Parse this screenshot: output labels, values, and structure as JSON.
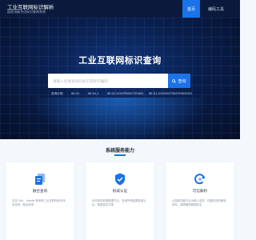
{
  "header": {
    "brand_title": "工业互联网标识解析",
    "brand_subtitle": "国家顶级节点标识查询系统",
    "nav": [
      {
        "label": "首页",
        "active": true
      },
      {
        "label": "编码工具",
        "active": false
      }
    ]
  },
  "hero": {
    "title": "工业互联网标识查询",
    "search": {
      "placeholder": "请输入您要查询的标识或标识编码",
      "value": "",
      "button_label": "查询"
    },
    "examples_label": "查询示例:",
    "examples": [
      "88.111",
      "88.111.1",
      "88.111.1010/PK00217R4811",
      "88.111.1010/0X2T0A22S0N12301"
    ]
  },
  "services": {
    "title": "系统服务能力",
    "cards": [
      {
        "icon": "document-stack-icon",
        "title": "融合查询",
        "desc": "支持 VAA、Handle 等多种工业互联网标识体系查询，融合查询"
      },
      {
        "icon": "shield-check-icon",
        "title": "权威认证",
        "desc": "标识机构权威数据节点，查询所得结果权威认证，数据真实可靠"
      },
      {
        "icon": "refresh-cycle-icon",
        "title": "可信解析",
        "desc": "以国家顶级节点为核心支撑，构建可信的解析体系，保障解析数据安全"
      }
    ]
  },
  "colors": {
    "accent": "#1a73e8",
    "header_bg": "#0b1a3c",
    "page_bg": "#f4f7fb"
  }
}
